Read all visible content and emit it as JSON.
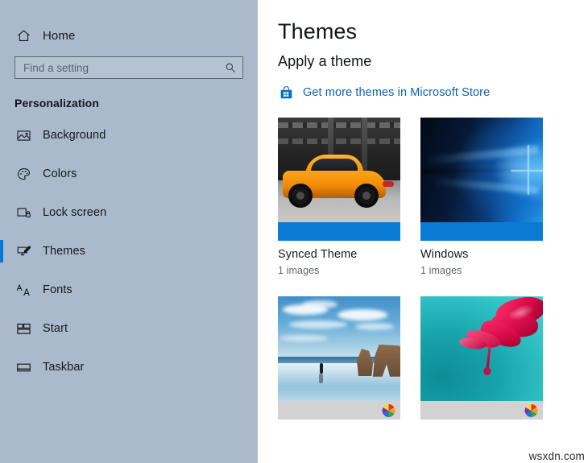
{
  "sidebar": {
    "home": {
      "label": "Home",
      "icon": "home-icon"
    },
    "search": {
      "value": "",
      "placeholder": "Find a setting",
      "icon": "search-icon"
    },
    "section_title": "Personalization",
    "items": [
      {
        "label": "Background",
        "icon": "picture-icon",
        "selected": false
      },
      {
        "label": "Colors",
        "icon": "palette-icon",
        "selected": false
      },
      {
        "label": "Lock screen",
        "icon": "lock-screen-icon",
        "selected": false
      },
      {
        "label": "Themes",
        "icon": "themes-brush-icon",
        "selected": true
      },
      {
        "label": "Fonts",
        "icon": "fonts-aa-icon",
        "selected": false
      },
      {
        "label": "Start",
        "icon": "start-tiles-icon",
        "selected": false
      },
      {
        "label": "Taskbar",
        "icon": "taskbar-icon",
        "selected": false
      }
    ]
  },
  "main": {
    "page_title": "Themes",
    "subhead": "Apply a theme",
    "store_link": {
      "label": "Get more themes in Microsoft Store",
      "icon": "microsoft-store-icon"
    },
    "themes": [
      {
        "name": "Synced Theme",
        "count": "1 images",
        "accent": "blue",
        "art": "car",
        "wheel": false
      },
      {
        "name": "Windows",
        "count": "1 images",
        "accent": "blue",
        "art": "win",
        "wheel": false
      },
      {
        "name": "",
        "count": "",
        "accent": "gray",
        "art": "beach",
        "wheel": true
      },
      {
        "name": "",
        "count": "",
        "accent": "gray",
        "art": "flower",
        "wheel": true
      }
    ]
  },
  "watermark": "wsxdn.com",
  "colors": {
    "sidebar_bg": "#aab9cc",
    "accent_blue": "#0078d7",
    "card_accent_blue": "#0a7bd4",
    "card_accent_gray": "#d2d2d2",
    "link_blue": "#0a62b5",
    "text_primary": "#14181c",
    "text_secondary": "#5f656c"
  }
}
